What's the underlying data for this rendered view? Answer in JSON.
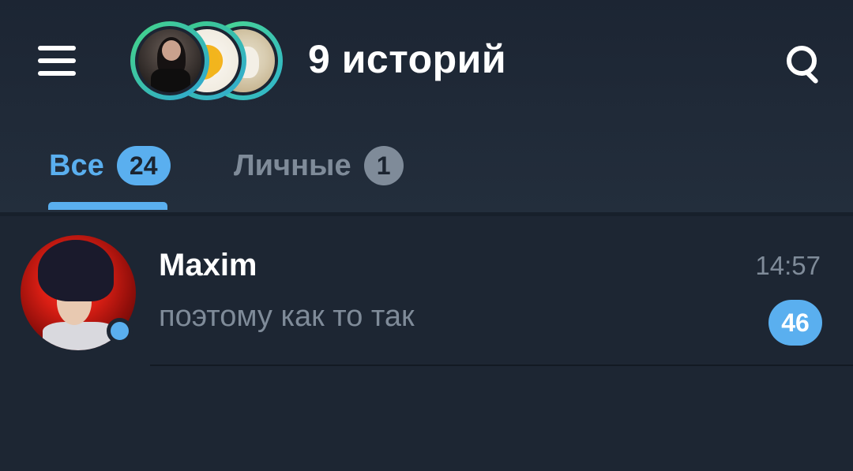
{
  "header": {
    "menu_icon": "hamburger-menu-icon",
    "stories_title": "9 историй",
    "search_icon": "search-icon",
    "stories": [
      {
        "name": "story-1",
        "ring_color": "#45d686"
      },
      {
        "name": "story-2",
        "ring_color": "#3fd183"
      },
      {
        "name": "story-3",
        "ring_color": "#4cd98a"
      }
    ]
  },
  "tabs": [
    {
      "label": "Все",
      "count": "24",
      "active": true
    },
    {
      "label": "Личные",
      "count": "1",
      "active": false
    }
  ],
  "chats": [
    {
      "name": "Maxim",
      "time": "14:57",
      "preview": "поэтому как то так",
      "unread": "46",
      "online": true
    }
  ],
  "colors": {
    "background": "#1d2633",
    "accent": "#5aafef",
    "muted": "#7f8b99",
    "text": "#ffffff"
  }
}
